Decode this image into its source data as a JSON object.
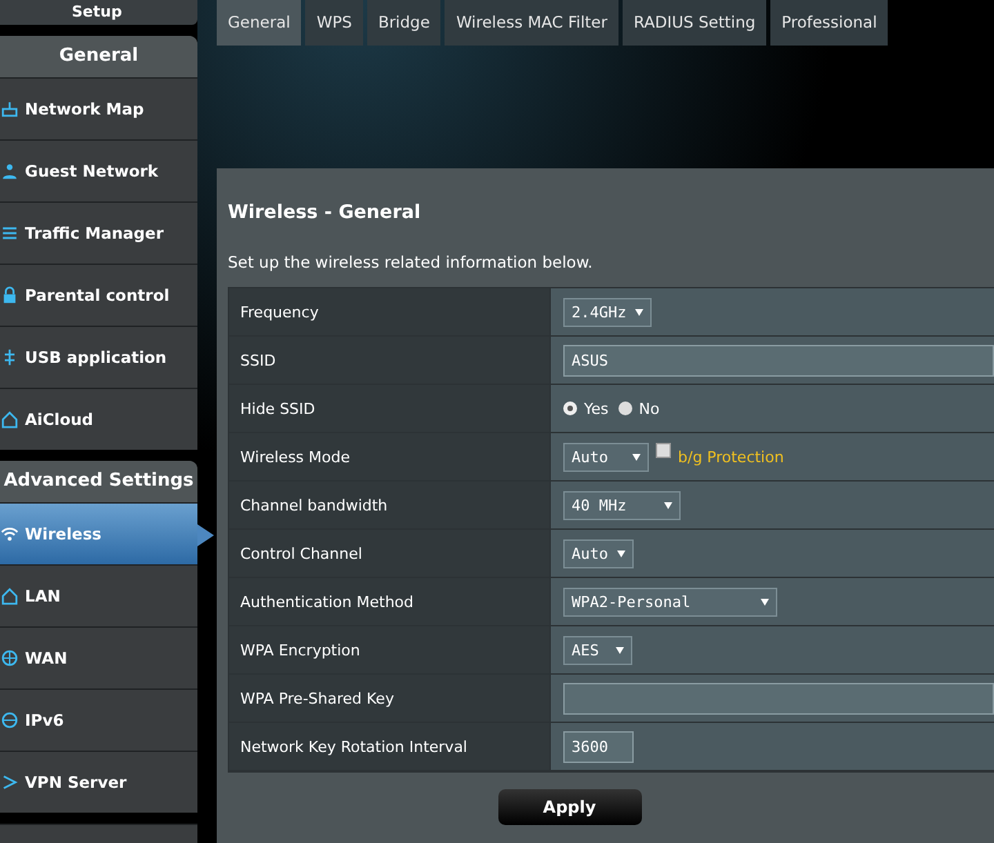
{
  "setup_button": {
    "label": "Setup"
  },
  "sidebar": {
    "sections": [
      {
        "title": "General",
        "items": [
          {
            "label": "Network Map",
            "selected": false
          },
          {
            "label": "Guest Network",
            "selected": false
          },
          {
            "label": "Traffic Manager",
            "selected": false
          },
          {
            "label": "Parental control",
            "selected": false
          },
          {
            "label": "USB application",
            "selected": false
          },
          {
            "label": "AiCloud",
            "selected": false
          }
        ]
      },
      {
        "title": "Advanced Settings",
        "items": [
          {
            "label": "Wireless",
            "selected": true
          },
          {
            "label": "LAN",
            "selected": false
          },
          {
            "label": "WAN",
            "selected": false
          },
          {
            "label": "IPv6",
            "selected": false
          },
          {
            "label": "VPN Server",
            "selected": false
          }
        ]
      }
    ]
  },
  "tabs": [
    {
      "label": "General",
      "selected": true
    },
    {
      "label": "WPS",
      "selected": false
    },
    {
      "label": "Bridge",
      "selected": false
    },
    {
      "label": "Wireless MAC Filter",
      "selected": false
    },
    {
      "label": "RADIUS Setting",
      "selected": false
    },
    {
      "label": "Professional",
      "selected": false
    }
  ],
  "panel": {
    "title": "Wireless - General",
    "description": "Set up the wireless related information below.",
    "rows": [
      {
        "label": "Frequency",
        "kind": "select",
        "value": "2.4GHz"
      },
      {
        "label": "SSID",
        "kind": "text",
        "value": "ASUS"
      },
      {
        "label": "Hide SSID",
        "kind": "radio",
        "options": [
          {
            "label": "Yes",
            "selected": true
          },
          {
            "label": "No",
            "selected": false
          }
        ]
      },
      {
        "label": "Wireless Mode",
        "kind": "select_check",
        "value": "Auto",
        "check": {
          "label": "b/g Protection",
          "checked": false
        }
      },
      {
        "label": "Channel bandwidth",
        "kind": "select",
        "value": "40 MHz"
      },
      {
        "label": "Control Channel",
        "kind": "select",
        "value": "Auto"
      },
      {
        "label": "Authentication Method",
        "kind": "select",
        "value": "WPA2-Personal"
      },
      {
        "label": "WPA Encryption",
        "kind": "select",
        "value": "AES"
      },
      {
        "label": "WPA Pre-Shared Key",
        "kind": "text",
        "value": ""
      },
      {
        "label": "Network Key Rotation Interval",
        "kind": "short",
        "value": "3600"
      }
    ],
    "apply_button": "Apply"
  }
}
